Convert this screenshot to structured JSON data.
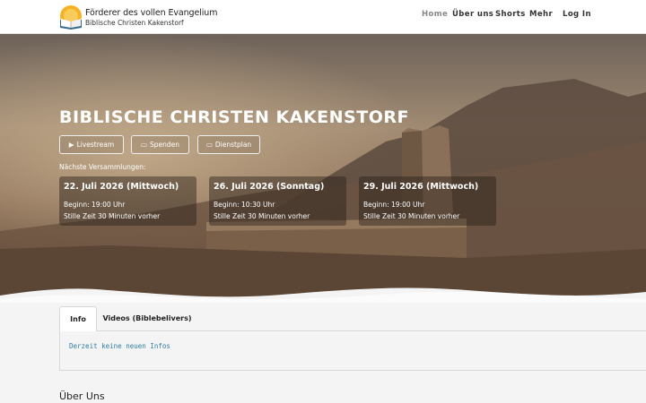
{
  "logo": {
    "title": "Förderer des vollen Evangelium",
    "subtitle": "Biblische Christen Kakenstorf",
    "icon": "open-bible-icon"
  },
  "nav": {
    "items": [
      {
        "label": "Home",
        "active": true
      },
      {
        "label": "Über uns"
      },
      {
        "label": "Shorts"
      },
      {
        "label": "Mehr"
      },
      {
        "label": "Log In"
      }
    ]
  },
  "hero": {
    "title": "BIBLISCHE CHRISTEN KAKENSTORF",
    "buttons": [
      {
        "icon": "▶",
        "label": "Livestream"
      },
      {
        "icon": "▭",
        "label": "Spenden"
      },
      {
        "icon": "▭",
        "label": "Dienstplan"
      }
    ],
    "next_label": "Nächste Versammlungen:",
    "events": [
      {
        "date": "22. Juli 2026 (Mittwoch)",
        "begin": "Beginn: 19:00 Uhr",
        "silent": "Stille Zeit 30 Minuten vorher"
      },
      {
        "date": "26. Juli 2026 (Sonntag)",
        "begin": "Beginn: 10:30 Uhr",
        "silent": "Stille Zeit 30 Minuten vorher"
      },
      {
        "date": "29. Juli 2026 (Mittwoch)",
        "begin": "Beginn: 19:00 Uhr",
        "silent": "Stille Zeit 30 Minuten vorher"
      }
    ]
  },
  "tabs": {
    "items": [
      {
        "label": "Info",
        "active": true
      },
      {
        "label": "Videos (Biblebelivers)"
      }
    ],
    "panel_text": "Derzeit keine neuen Infos"
  },
  "about": {
    "heading": "Über Uns"
  },
  "colors": {
    "accent_link": "#2d7fa8",
    "nav_active": "#888888"
  }
}
